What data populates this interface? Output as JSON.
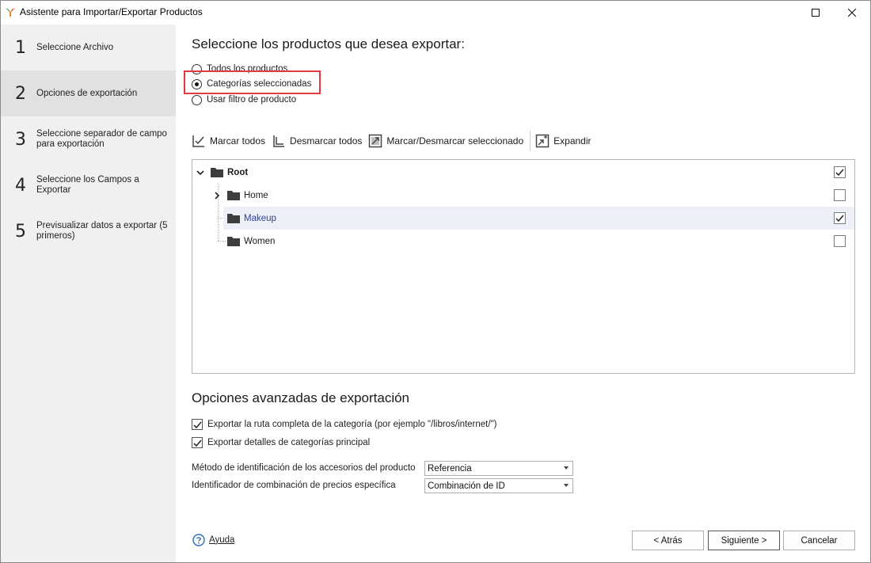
{
  "window": {
    "title": "Asistente para Importar/Exportar Productos"
  },
  "sidebar": {
    "steps": [
      {
        "num": "1",
        "label": "Seleccione Archivo"
      },
      {
        "num": "2",
        "label": "Opciones de exportación"
      },
      {
        "num": "3",
        "label": "Seleccione separador de campo para exportación"
      },
      {
        "num": "4",
        "label": "Seleccione los Campos a Exportar"
      },
      {
        "num": "5",
        "label": "Previsualizar datos a exportar (5 primeros)"
      }
    ],
    "active_step": 2
  },
  "main": {
    "heading": "Seleccione los productos que desea exportar:",
    "radios": [
      {
        "label": "Todos los productos",
        "checked": false
      },
      {
        "label": "Categorías seleccionadas",
        "checked": true
      },
      {
        "label": "Usar filtro de producto",
        "checked": false
      }
    ],
    "toolbar": {
      "check_all": "Marcar todos",
      "uncheck_all": "Desmarcar todos",
      "toggle_selected": "Marcar/Desmarcar seleccionado",
      "expand": "Expandir"
    },
    "tree": [
      {
        "label": "Root",
        "checked": true,
        "expanded": true,
        "level": 0
      },
      {
        "label": "Home",
        "checked": false,
        "expanded": false,
        "level": 1
      },
      {
        "label": "Makeup",
        "checked": true,
        "level": 1,
        "selected": true
      },
      {
        "label": "Women",
        "checked": false,
        "level": 1
      }
    ],
    "advanced": {
      "heading": "Opciones avanzadas de exportación",
      "check_full_path": "Exportar la ruta completa de la categoría (por ejemplo \"/libros/internet/\")",
      "check_full_path_checked": true,
      "check_parent_details": "Exportar detalles de categorías principal",
      "check_parent_details_checked": true,
      "accessories_label": "Método de identificación de los accesorios del producto",
      "accessories_value": "Referencia",
      "combination_label": "Identificador de combinación de precios específica",
      "combination_value": "Combinación de ID"
    }
  },
  "footer": {
    "help": "Ayuda",
    "back": "< Atrás",
    "next": "Siguiente >",
    "cancel": "Cancelar"
  },
  "colors": {
    "highlight_border": "#e0393e",
    "selected_row": "#eef0f7",
    "sidebar_bg": "#f0f0f0",
    "sidebar_active_bg": "#e1e1e1"
  }
}
